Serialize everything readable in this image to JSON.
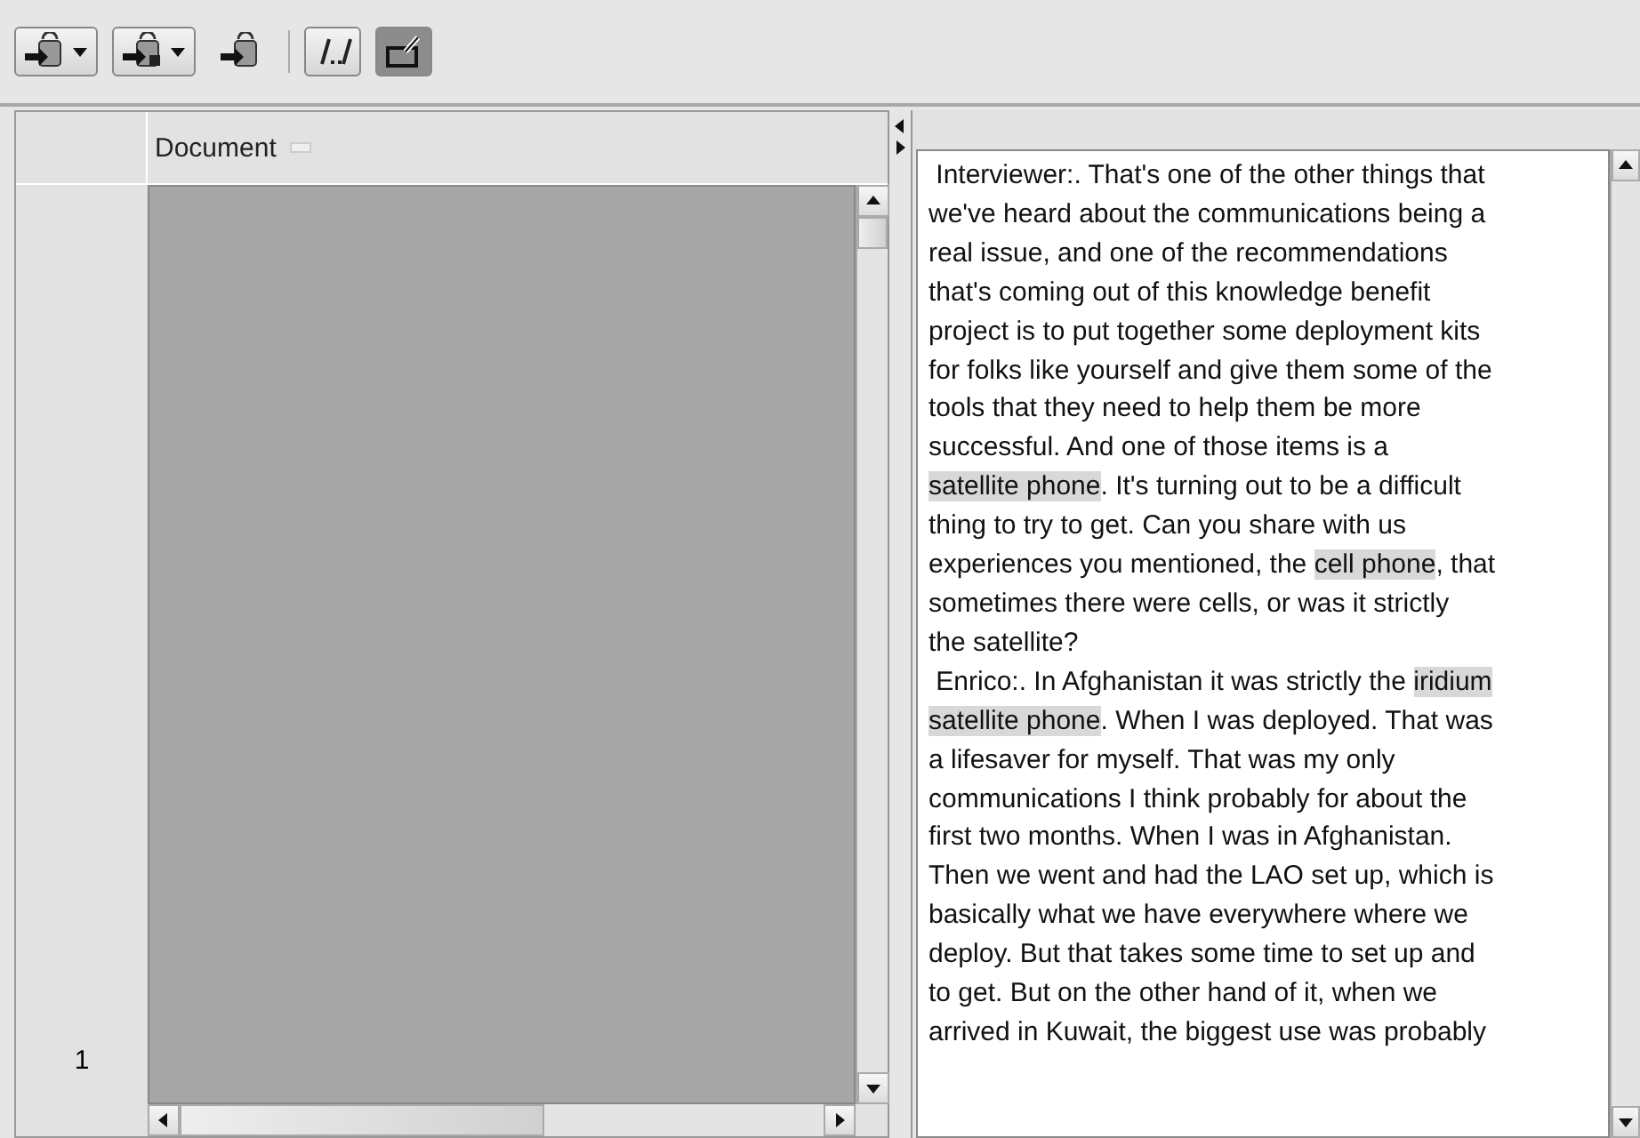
{
  "toolbar": {
    "tools": [
      {
        "kind": "dropdown"
      },
      {
        "kind": "dropdown"
      },
      {
        "kind": "plain"
      },
      {
        "kind": "separator"
      },
      {
        "kind": "toggle",
        "selected": false
      },
      {
        "kind": "toggle",
        "selected": true
      }
    ]
  },
  "table": {
    "columns": [
      "Document"
    ],
    "rows": [
      {
        "number": "1"
      }
    ]
  },
  "transcript": {
    "lines": [
      [
        {
          "text": " Interviewer:. That's one of the other things that",
          "highlighted": false
        }
      ],
      [
        {
          "text": "we've heard about the communications being a",
          "highlighted": false
        }
      ],
      [
        {
          "text": "real issue, and one of the recommendations",
          "highlighted": false
        }
      ],
      [
        {
          "text": "that's coming out of this knowledge benefit",
          "highlighted": false
        }
      ],
      [
        {
          "text": "project is to put together some deployment kits",
          "highlighted": false
        }
      ],
      [
        {
          "text": "for folks like yourself and give them some of the",
          "highlighted": false
        }
      ],
      [
        {
          "text": "tools that they need to help them be more",
          "highlighted": false
        }
      ],
      [
        {
          "text": "successful. And one of those items is a",
          "highlighted": false
        }
      ],
      [
        {
          "text": "satellite phone",
          "highlighted": true
        },
        {
          "text": ". It's turning out to be a difficult",
          "highlighted": false
        }
      ],
      [
        {
          "text": "thing to try to get. Can you share with us",
          "highlighted": false
        }
      ],
      [
        {
          "text": "experiences you mentioned, the ",
          "highlighted": false
        },
        {
          "text": "cell phone",
          "highlighted": true
        },
        {
          "text": ", that",
          "highlighted": false
        }
      ],
      [
        {
          "text": "sometimes there were cells, or was it strictly",
          "highlighted": false
        }
      ],
      [
        {
          "text": "the satellite?",
          "highlighted": false
        }
      ],
      [
        {
          "text": " Enrico:. In Afghanistan it was strictly the ",
          "highlighted": false
        },
        {
          "text": "iridium",
          "highlighted": true
        }
      ],
      [
        {
          "text": "satellite phone",
          "highlighted": true
        },
        {
          "text": ". When I was deployed. That was",
          "highlighted": false
        }
      ],
      [
        {
          "text": "a lifesaver for myself. That was my only",
          "highlighted": false
        }
      ],
      [
        {
          "text": "communications I think probably for about the",
          "highlighted": false
        }
      ],
      [
        {
          "text": "first two months. When I was in Afghanistan.",
          "highlighted": false
        }
      ],
      [
        {
          "text": "Then we went and had the LAO set up, which is",
          "highlighted": false
        }
      ],
      [
        {
          "text": "basically what we have everywhere where we",
          "highlighted": false
        }
      ],
      [
        {
          "text": "deploy. But that takes some time to set up and",
          "highlighted": false
        }
      ],
      [
        {
          "text": "to get. But on the other hand of it, when we",
          "highlighted": false
        }
      ],
      [
        {
          "text": "arrived in Kuwait, the biggest use was probably",
          "highlighted": false
        }
      ]
    ]
  }
}
